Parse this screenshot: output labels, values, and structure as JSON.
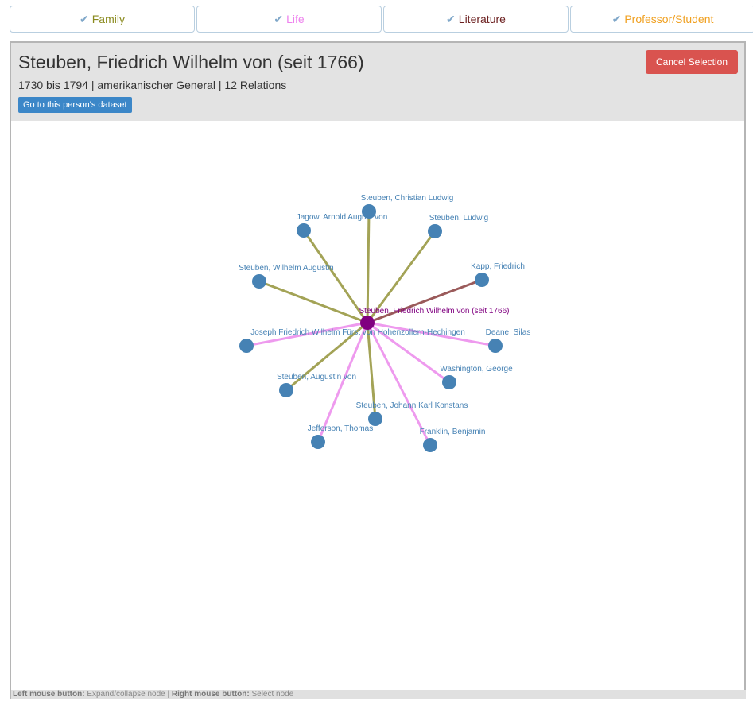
{
  "tabs": [
    {
      "label": "Family",
      "color": "#8a8a1e",
      "check_color": "#7fa7c9"
    },
    {
      "label": "Life",
      "color": "#ee82ee",
      "check_color": "#7fa7c9"
    },
    {
      "label": "Literature",
      "color": "#6b1f1f",
      "check_color": "#7fa7c9"
    },
    {
      "label": "Professor/Student",
      "color": "#f0a020",
      "check_color": "#7fa7c9"
    }
  ],
  "person": {
    "name": "Steuben, Friedrich Wilhelm von (seit 1766)",
    "meta": "1730 bis 1794 | amerikanischer General | 12 Relations",
    "dataset_button": "Go to this person's dataset"
  },
  "cancel_button": "Cancel Selection",
  "graph": {
    "center": {
      "label": "Steuben, Friedrich Wilhelm von (seit 1766)",
      "color": "#800080"
    },
    "node_color": "#4682b4",
    "edge_colors": {
      "family": "#a3a356",
      "life": "#ee9aee",
      "literature": "#9a5a5a"
    },
    "nodes": [
      {
        "label": "Steuben, Christian Ludwig",
        "relation": "family"
      },
      {
        "label": "Jagow, Arnold August von",
        "relation": "family"
      },
      {
        "label": "Steuben, Ludwig",
        "relation": "family"
      },
      {
        "label": "Kapp, Friedrich",
        "relation": "literature"
      },
      {
        "label": "Steuben, Wilhelm Augustin",
        "relation": "family"
      },
      {
        "label": "Joseph Friedrich Wilhelm Fürst von Hohenzollern-Hechingen",
        "relation": "life"
      },
      {
        "label": "Deane, Silas",
        "relation": "life"
      },
      {
        "label": "Washington, George",
        "relation": "life"
      },
      {
        "label": "Steuben, Augustin von",
        "relation": "family"
      },
      {
        "label": "Steuben, Johann Karl Konstans",
        "relation": "family"
      },
      {
        "label": "Jefferson, Thomas",
        "relation": "life"
      },
      {
        "label": "Franklin, Benjamin",
        "relation": "life"
      }
    ]
  },
  "footer": {
    "left_label": "Left mouse button:",
    "left_text": "Expand/collapse node",
    "separator": "|",
    "right_label": "Right mouse button:",
    "right_text": "Select node"
  }
}
